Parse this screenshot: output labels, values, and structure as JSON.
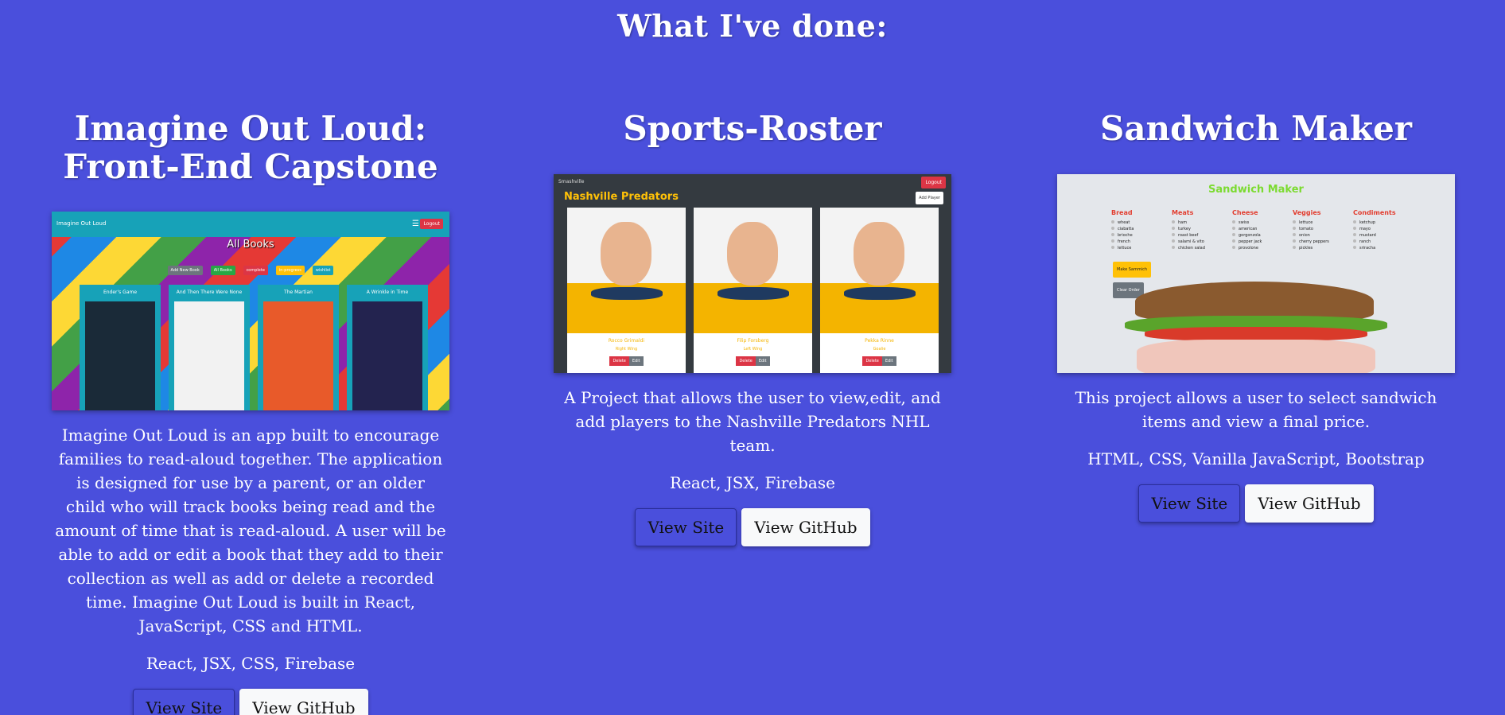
{
  "heading": "What I've done:",
  "projects": [
    {
      "title": "Imagine Out Loud: Front-End Capstone",
      "description": "Imagine Out Loud is an app built to encourage families to read-aloud together. The application is designed for use by a parent, or an older child who will track books being read and the amount of time that is read-aloud. A user will be able to add or edit a book that they add to their collection as well as add or delete a recorded time. Imagine Out Loud is built in React, JavaScript, CSS and HTML.",
      "tech": "React, JSX, CSS, Firebase",
      "site_label": "View Site",
      "github_label": "View GitHub",
      "screenshot": {
        "app_name": "Imagine Out Loud",
        "logout": "Logout",
        "title": "All Books",
        "chips": [
          "Add New Book",
          "All Books",
          "complete",
          "in-progress",
          "wishlist"
        ],
        "chip_colors": [
          "#6c757d",
          "#28a745",
          "#dc3545",
          "#ffc107",
          "#17a2b8"
        ],
        "books": [
          "Ender's Game",
          "And Then There Were None",
          "The Martian",
          "A Wrinkle in Time"
        ],
        "cover_colors": [
          "#1a2a38",
          "#f2f2f2",
          "#e85a2a",
          "#23234f"
        ]
      }
    },
    {
      "title": "Sports-Roster",
      "description": "A Project that allows the user to view,edit, and add players to the Nashville Predators NHL team.",
      "tech": "React, JSX, Firebase",
      "site_label": "View Site",
      "github_label": "View GitHub",
      "screenshot": {
        "nav": "Smashville",
        "logout": "Logout",
        "team": "Nashville Predators",
        "add": "Add Player",
        "players": [
          {
            "name": "Rocco Grimaldi",
            "position": "Right Wing"
          },
          {
            "name": "Filip Forsberg",
            "position": "Left Wing"
          },
          {
            "name": "Pekka Rinne",
            "position": "Goalie"
          }
        ],
        "delete": "Delete",
        "edit": "Edit"
      }
    },
    {
      "title": "Sandwich Maker",
      "description": "This project allows a user to select sandwich items and view a final price.",
      "tech": "HTML, CSS, Vanilla JavaScript, Bootstrap",
      "site_label": "View Site",
      "github_label": "View GitHub",
      "screenshot": {
        "title": "Sandwich Maker",
        "categories": [
          {
            "name": "Bread",
            "items": [
              "wheat",
              "ciabatta",
              "brioche",
              "french",
              "lettuce"
            ]
          },
          {
            "name": "Meats",
            "items": [
              "ham",
              "turkey",
              "roast beef",
              "salami & vito",
              "chicken salad"
            ]
          },
          {
            "name": "Cheese",
            "items": [
              "swiss",
              "american",
              "gorgonzola",
              "pepper jack",
              "provolone"
            ]
          },
          {
            "name": "Veggies",
            "items": [
              "lettuce",
              "tomato",
              "onion",
              "cherry peppers",
              "pickles"
            ]
          },
          {
            "name": "Condiments",
            "items": [
              "ketchup",
              "mayo",
              "mustard",
              "ranch",
              "sriracha"
            ]
          }
        ],
        "make": "Make Sammich",
        "clear": "Clear Order"
      }
    }
  ]
}
